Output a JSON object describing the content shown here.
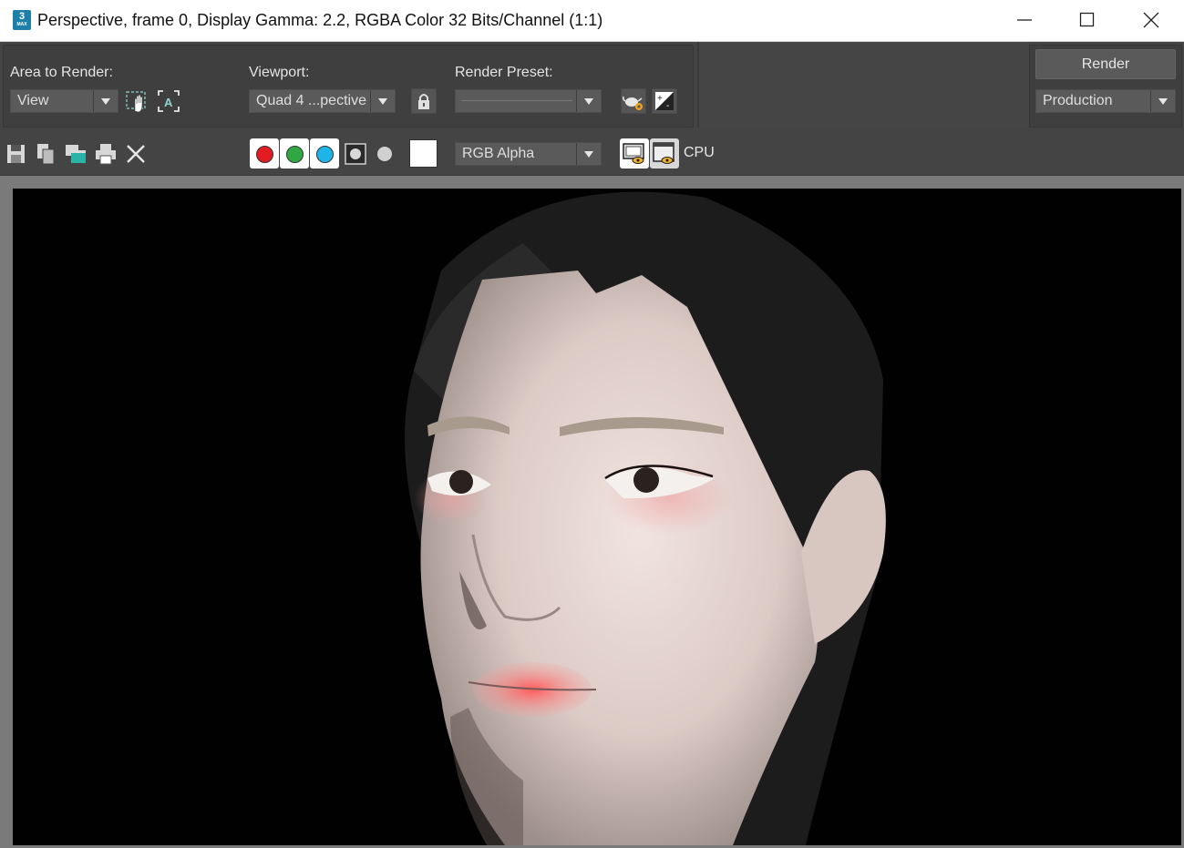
{
  "window": {
    "title": "Perspective, frame 0, Display Gamma: 2.2, RGBA Color 32 Bits/Channel (1:1)",
    "app_icon_text": "3",
    "app_icon_sub": "MAX"
  },
  "controls": {
    "area_label": "Area to Render:",
    "area_value": "View",
    "viewport_label": "Viewport:",
    "viewport_value": "Quad 4 ...pective",
    "preset_label": "Render Preset:",
    "preset_value": "",
    "render_button": "Render",
    "mode_value": "Production"
  },
  "toolbar": {
    "channel_display": "RGB Alpha",
    "renderer_label": "CPU",
    "channel_colors": {
      "red": "#e31b23",
      "green": "#2fa843",
      "blue": "#1eb4e8"
    },
    "swatch_color": "#ffffff"
  },
  "render": {
    "background": "#010101",
    "description_icon": "render-image"
  }
}
